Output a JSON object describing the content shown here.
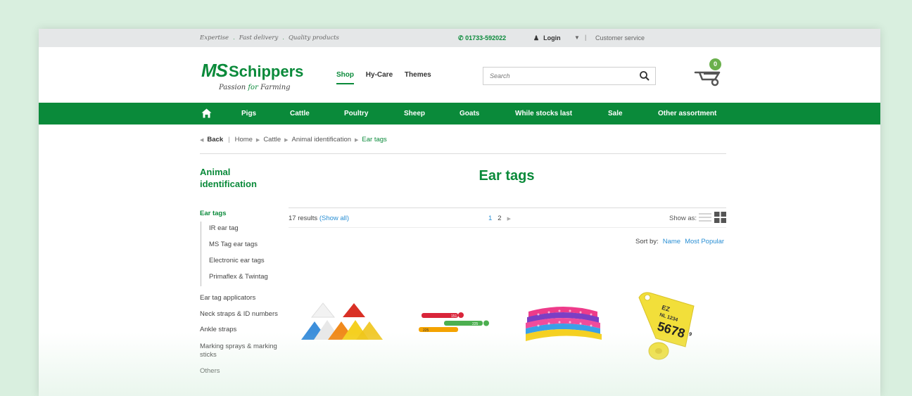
{
  "topbar": {
    "usp1": "Expertise",
    "usp2": "Fast delivery",
    "usp3": "Quality products",
    "phone": "01733-592022",
    "login": "Login",
    "customer_service": "Customer service"
  },
  "logo": {
    "ms": "MS",
    "name": "Schippers",
    "tag_pre": "Passion",
    "tag_for": "for",
    "tag_post": "Farming"
  },
  "mainnav": [
    "Shop",
    "Hy-Care",
    "Themes"
  ],
  "search": {
    "placeholder": "Search"
  },
  "cart": {
    "count": "0"
  },
  "catnav": [
    "Pigs",
    "Cattle",
    "Poultry",
    "Sheep",
    "Goats",
    "While stocks last",
    "Sale",
    "Other assortment"
  ],
  "breadcrumb": {
    "back": "Back",
    "items": [
      "Home",
      "Cattle",
      "Animal identification"
    ],
    "current": "Ear tags"
  },
  "sidebar": {
    "title": "Animal identification",
    "active": "Ear tags",
    "sub": [
      "IR ear tag",
      "MS Tag ear tags",
      "Electronic ear tags",
      "Primaflex & Twintag"
    ],
    "items": [
      "Ear tag applicators",
      "Neck straps & ID numbers",
      "Ankle straps",
      "Marking sprays & marking sticks",
      "Others"
    ]
  },
  "content": {
    "title": "Ear tags",
    "results": "17 results",
    "show_all": "(Show all)",
    "pages": [
      "1",
      "2"
    ],
    "show_as": "Show as:",
    "sort_by": "Sort by:",
    "sort_options": [
      "Name",
      "Most Popular"
    ]
  },
  "products": {
    "tag_numbers": [
      "151",
      "225",
      "225"
    ],
    "big_tag": {
      "line1": "EZ",
      "line2": "NL 1234",
      "number": "5678",
      "small": "9"
    }
  },
  "colors": {
    "brand_green": "#0a8a3a",
    "link_blue": "#2a8fd4",
    "badge_green": "#6ab04c"
  }
}
